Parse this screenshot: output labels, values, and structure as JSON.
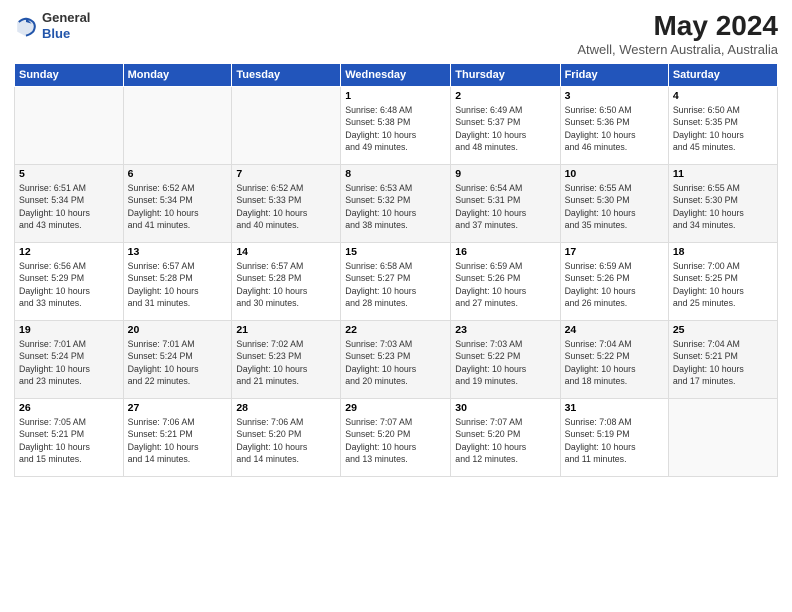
{
  "header": {
    "logo_line1": "General",
    "logo_line2": "Blue",
    "month": "May 2024",
    "location": "Atwell, Western Australia, Australia"
  },
  "days_of_week": [
    "Sunday",
    "Monday",
    "Tuesday",
    "Wednesday",
    "Thursday",
    "Friday",
    "Saturday"
  ],
  "weeks": [
    [
      {
        "day": "",
        "info": ""
      },
      {
        "day": "",
        "info": ""
      },
      {
        "day": "",
        "info": ""
      },
      {
        "day": "1",
        "info": "Sunrise: 6:48 AM\nSunset: 5:38 PM\nDaylight: 10 hours\nand 49 minutes."
      },
      {
        "day": "2",
        "info": "Sunrise: 6:49 AM\nSunset: 5:37 PM\nDaylight: 10 hours\nand 48 minutes."
      },
      {
        "day": "3",
        "info": "Sunrise: 6:50 AM\nSunset: 5:36 PM\nDaylight: 10 hours\nand 46 minutes."
      },
      {
        "day": "4",
        "info": "Sunrise: 6:50 AM\nSunset: 5:35 PM\nDaylight: 10 hours\nand 45 minutes."
      }
    ],
    [
      {
        "day": "5",
        "info": "Sunrise: 6:51 AM\nSunset: 5:34 PM\nDaylight: 10 hours\nand 43 minutes."
      },
      {
        "day": "6",
        "info": "Sunrise: 6:52 AM\nSunset: 5:34 PM\nDaylight: 10 hours\nand 41 minutes."
      },
      {
        "day": "7",
        "info": "Sunrise: 6:52 AM\nSunset: 5:33 PM\nDaylight: 10 hours\nand 40 minutes."
      },
      {
        "day": "8",
        "info": "Sunrise: 6:53 AM\nSunset: 5:32 PM\nDaylight: 10 hours\nand 38 minutes."
      },
      {
        "day": "9",
        "info": "Sunrise: 6:54 AM\nSunset: 5:31 PM\nDaylight: 10 hours\nand 37 minutes."
      },
      {
        "day": "10",
        "info": "Sunrise: 6:55 AM\nSunset: 5:30 PM\nDaylight: 10 hours\nand 35 minutes."
      },
      {
        "day": "11",
        "info": "Sunrise: 6:55 AM\nSunset: 5:30 PM\nDaylight: 10 hours\nand 34 minutes."
      }
    ],
    [
      {
        "day": "12",
        "info": "Sunrise: 6:56 AM\nSunset: 5:29 PM\nDaylight: 10 hours\nand 33 minutes."
      },
      {
        "day": "13",
        "info": "Sunrise: 6:57 AM\nSunset: 5:28 PM\nDaylight: 10 hours\nand 31 minutes."
      },
      {
        "day": "14",
        "info": "Sunrise: 6:57 AM\nSunset: 5:28 PM\nDaylight: 10 hours\nand 30 minutes."
      },
      {
        "day": "15",
        "info": "Sunrise: 6:58 AM\nSunset: 5:27 PM\nDaylight: 10 hours\nand 28 minutes."
      },
      {
        "day": "16",
        "info": "Sunrise: 6:59 AM\nSunset: 5:26 PM\nDaylight: 10 hours\nand 27 minutes."
      },
      {
        "day": "17",
        "info": "Sunrise: 6:59 AM\nSunset: 5:26 PM\nDaylight: 10 hours\nand 26 minutes."
      },
      {
        "day": "18",
        "info": "Sunrise: 7:00 AM\nSunset: 5:25 PM\nDaylight: 10 hours\nand 25 minutes."
      }
    ],
    [
      {
        "day": "19",
        "info": "Sunrise: 7:01 AM\nSunset: 5:24 PM\nDaylight: 10 hours\nand 23 minutes."
      },
      {
        "day": "20",
        "info": "Sunrise: 7:01 AM\nSunset: 5:24 PM\nDaylight: 10 hours\nand 22 minutes."
      },
      {
        "day": "21",
        "info": "Sunrise: 7:02 AM\nSunset: 5:23 PM\nDaylight: 10 hours\nand 21 minutes."
      },
      {
        "day": "22",
        "info": "Sunrise: 7:03 AM\nSunset: 5:23 PM\nDaylight: 10 hours\nand 20 minutes."
      },
      {
        "day": "23",
        "info": "Sunrise: 7:03 AM\nSunset: 5:22 PM\nDaylight: 10 hours\nand 19 minutes."
      },
      {
        "day": "24",
        "info": "Sunrise: 7:04 AM\nSunset: 5:22 PM\nDaylight: 10 hours\nand 18 minutes."
      },
      {
        "day": "25",
        "info": "Sunrise: 7:04 AM\nSunset: 5:21 PM\nDaylight: 10 hours\nand 17 minutes."
      }
    ],
    [
      {
        "day": "26",
        "info": "Sunrise: 7:05 AM\nSunset: 5:21 PM\nDaylight: 10 hours\nand 15 minutes."
      },
      {
        "day": "27",
        "info": "Sunrise: 7:06 AM\nSunset: 5:21 PM\nDaylight: 10 hours\nand 14 minutes."
      },
      {
        "day": "28",
        "info": "Sunrise: 7:06 AM\nSunset: 5:20 PM\nDaylight: 10 hours\nand 14 minutes."
      },
      {
        "day": "29",
        "info": "Sunrise: 7:07 AM\nSunset: 5:20 PM\nDaylight: 10 hours\nand 13 minutes."
      },
      {
        "day": "30",
        "info": "Sunrise: 7:07 AM\nSunset: 5:20 PM\nDaylight: 10 hours\nand 12 minutes."
      },
      {
        "day": "31",
        "info": "Sunrise: 7:08 AM\nSunset: 5:19 PM\nDaylight: 10 hours\nand 11 minutes."
      },
      {
        "day": "",
        "info": ""
      }
    ]
  ]
}
